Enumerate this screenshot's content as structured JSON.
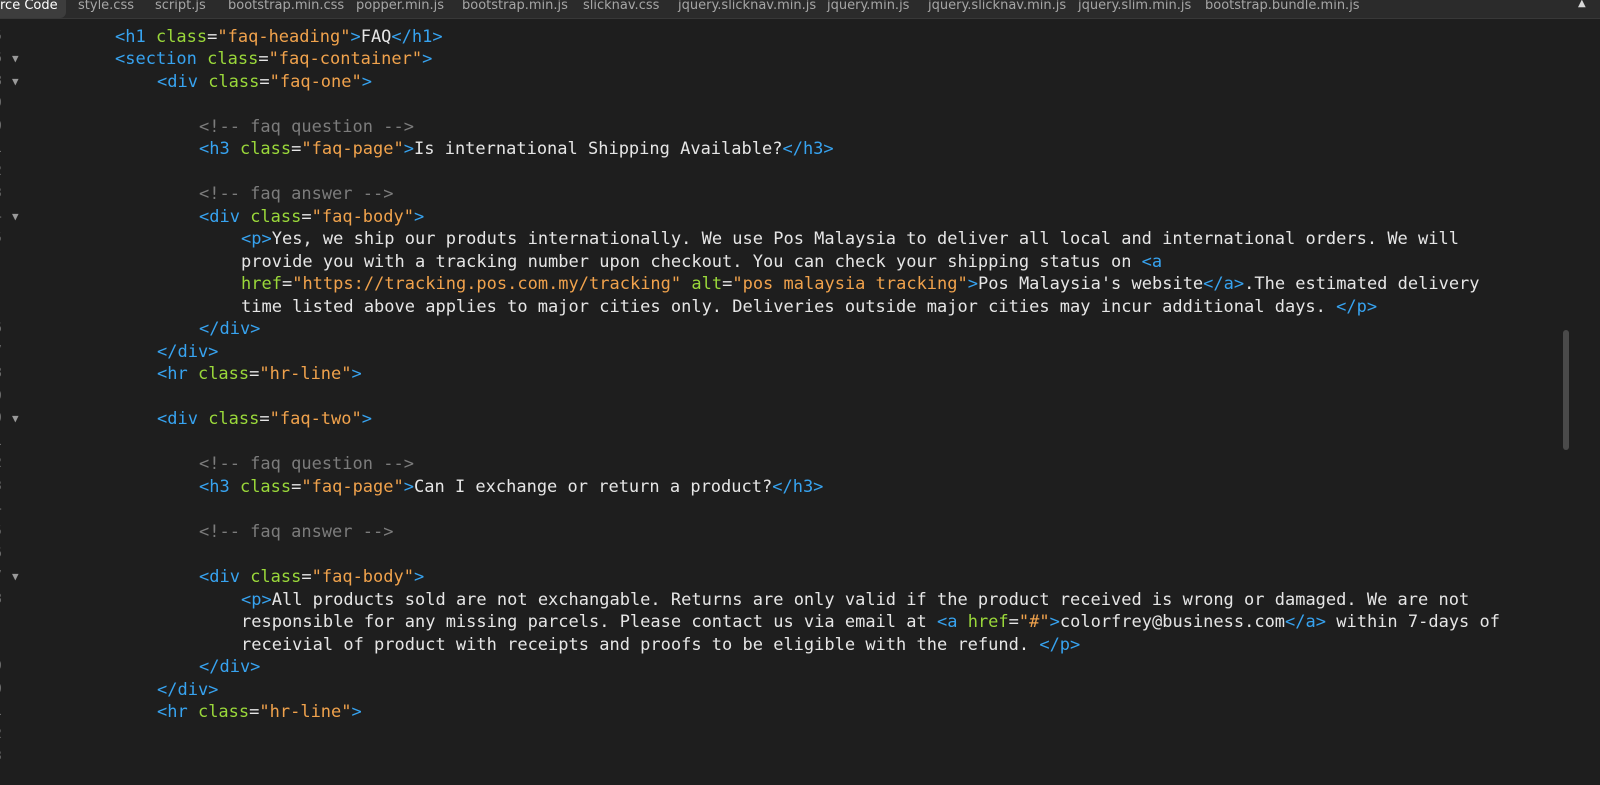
{
  "tabs": [
    {
      "label": "rce Code",
      "active": true
    },
    {
      "label": "style.css"
    },
    {
      "label": "script.js"
    },
    {
      "label": "bootstrap.min.css"
    },
    {
      "label": "popper.min.js"
    },
    {
      "label": "bootstrap.min.js"
    },
    {
      "label": "slicknav.css"
    },
    {
      "label": "jquery.slicknav.min.js"
    },
    {
      "label": "jquery.min.js"
    },
    {
      "label": "jquery.slicknav.min.js"
    },
    {
      "label": "jquery.slim.min.js"
    },
    {
      "label": "bootstrap.bundle.min.js"
    }
  ],
  "gutter": {
    "numbers": [
      "5",
      "6",
      "8",
      "9",
      "0",
      "1",
      "2",
      "3",
      "4",
      "5",
      "",
      "6",
      "7",
      "8",
      "9",
      "0",
      "1",
      "2",
      "3",
      "4",
      "5",
      "6",
      "7",
      "8",
      "",
      "",
      "9",
      "0",
      "1",
      "2",
      "3"
    ],
    "fold_marker": "▼"
  },
  "code": {
    "line1": {
      "p1": "<h1",
      "p2": " class",
      "p3": "=",
      "p4": "\"faq-heading\"",
      "p5": ">",
      "p6": "FAQ",
      "p7": "</h1>"
    },
    "line2": {
      "p1": "<section",
      "p2": " class",
      "p3": "=",
      "p4": "\"faq-container\"",
      "p5": ">"
    },
    "line3": {
      "p1": "<div",
      "p2": " class",
      "p3": "=",
      "p4": "\"faq-one\"",
      "p5": ">"
    },
    "line5": {
      "p1": "<!-- faq question -->"
    },
    "line6": {
      "p1": "<h3",
      "p2": " class",
      "p3": "=",
      "p4": "\"faq-page\"",
      "p5": ">",
      "p6": "Is international Shipping Available?",
      "p7": "</h3>"
    },
    "line8": {
      "p1": "<!-- faq answer -->"
    },
    "line9": {
      "p1": "<div",
      "p2": " class",
      "p3": "=",
      "p4": "\"faq-body\"",
      "p5": ">"
    },
    "line10": {
      "p1": "<p>",
      "p2": "Yes, we ship our produts internationally. We use Pos Malaysia to deliver all local and international orders. We will"
    },
    "line11": {
      "p1": "provide you with a tracking number upon checkout. You can check your shipping status on ",
      "p2": "<a"
    },
    "line12": {
      "p1": "href",
      "p2": "=",
      "p3": "\"https://tracking.pos.com.my/tracking\"",
      "p4": " alt",
      "p5": "=",
      "p6": "\"pos malaysia tracking\"",
      "p7": ">",
      "p8": "Pos Malaysia's website",
      "p9": "</a>",
      "p10": ".The estimated delivery"
    },
    "line13": {
      "p1": "time listed above applies to major cities only. Deliveries outside major cities may incur additional days. ",
      "p2": "</p>"
    },
    "line14": {
      "p1": "</div>"
    },
    "line15": {
      "p1": "</div>"
    },
    "line16": {
      "p1": "<hr",
      "p2": " class",
      "p3": "=",
      "p4": "\"hr-line\"",
      "p5": ">"
    },
    "line18": {
      "p1": "<div",
      "p2": " class",
      "p3": "=",
      "p4": "\"faq-two\"",
      "p5": ">"
    },
    "line20": {
      "p1": "<!-- faq question -->"
    },
    "line21": {
      "p1": "<h3",
      "p2": " class",
      "p3": "=",
      "p4": "\"faq-page\"",
      "p5": ">",
      "p6": "Can I exchange or return a product?",
      "p7": "</h3>"
    },
    "line23": {
      "p1": "<!-- faq answer -->"
    },
    "line25": {
      "p1": "<div",
      "p2": " class",
      "p3": "=",
      "p4": "\"faq-body\"",
      "p5": ">"
    },
    "line26": {
      "p1": "<p>",
      "p2": "All products sold are not exchangable. Returns are only valid if the product received is wrong or damaged. We are not"
    },
    "line27": {
      "p1": "responsible for any missing parcels. Please contact us via email at ",
      "p2": "<a",
      "p3": " href",
      "p4": "=",
      "p5": "\"#\"",
      "p6": ">",
      "p7": "colorfrey@business.com",
      "p8": "</a>",
      "p9": " within 7-days of"
    },
    "line28": {
      "p1": "receivial of product with receipts and proofs to be eligible with the refund. ",
      "p2": "</p>"
    },
    "line29": {
      "p1": "</div>"
    },
    "line30": {
      "p1": "</div>"
    },
    "line31": {
      "p1": "<hr",
      "p2": " class",
      "p3": "=",
      "p4": "\"hr-line\"",
      "p5": ">"
    }
  },
  "colors": {
    "background": "#1e1e1e",
    "tag": "#37a3f0",
    "attribute": "#9ad83a",
    "string": "#f0a24c",
    "comment": "#7c7c7c",
    "text": "#e6e6e6"
  }
}
